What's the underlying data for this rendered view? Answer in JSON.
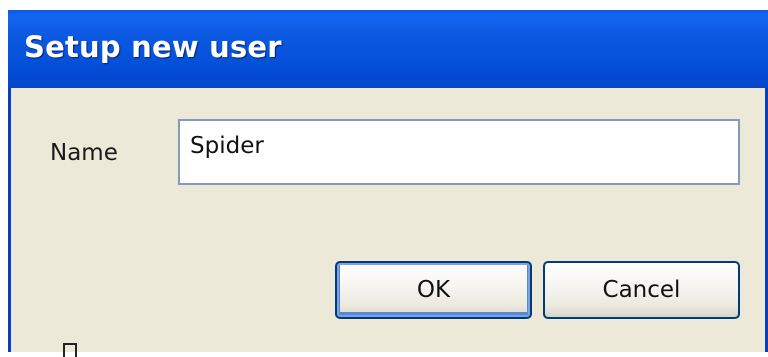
{
  "dialog": {
    "title": "Setup new user",
    "name_label": "Name",
    "name_value": "Spider",
    "ok_label": "OK",
    "cancel_label": "Cancel"
  },
  "colors": {
    "titlebar": "#0553dc",
    "window_bg": "#ece9d8",
    "input_border": "#7f9db9",
    "button_border": "#003c74",
    "default_button_focus": "#7ea0e6"
  }
}
